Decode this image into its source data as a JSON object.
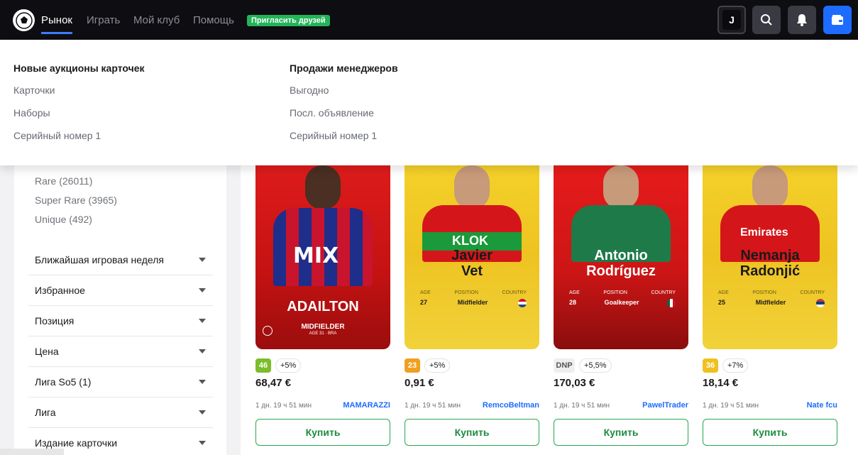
{
  "nav": {
    "items": [
      "Рынок",
      "Играть",
      "Мой клуб",
      "Помощь"
    ],
    "invite": "Пригласить друзей",
    "user_initial": "J"
  },
  "dropdown": {
    "left": {
      "title": "Новые аукционы карточек",
      "links": [
        "Карточки",
        "Наборы",
        "Серийный номер 1"
      ]
    },
    "right": {
      "title": "Продажи менеджеров",
      "links": [
        "Выгодно",
        "Посл. объявление",
        "Серийный номер 1"
      ]
    }
  },
  "sidebar": {
    "rarities": [
      "Rare (26011)",
      "Super Rare (3965)",
      "Unique (492)"
    ],
    "filters": [
      "Ближайшая игровая неделя",
      "Избранное",
      "Позиция",
      "Цена",
      "Лига So5 (1)",
      "Лига",
      "Издание карточки"
    ]
  },
  "cards": [
    {
      "name": "ADAILTON",
      "position": "MIDFIELDER",
      "sub": "AGE 31 · BRA",
      "score": "46",
      "score_color": "#7cbd2a",
      "delta": "+5%",
      "price": "68,47 €",
      "time": "1 дн. 19 ч 51 мин",
      "seller": "MAMARAZZI",
      "buy": "Купить"
    },
    {
      "name_line1": "Javier",
      "name_line2": "Vet",
      "age_label": "AGE",
      "position_label": "POSITION",
      "country_label": "COUNTRY",
      "age": "27",
      "position": "Midfielder",
      "score": "23",
      "score_color": "#f0a020",
      "delta": "+5%",
      "price": "0,91 €",
      "time": "1 дн. 19 ч 51 мин",
      "seller": "RemcoBeltman",
      "buy": "Купить"
    },
    {
      "name_line1": "Antonio",
      "name_line2": "Rodríguez",
      "age_label": "AGE",
      "position_label": "POSITION",
      "country_label": "COUNTRY",
      "age": "28",
      "position": "Goalkeeper",
      "score": "DNP",
      "delta": "+5,5%",
      "price": "170,03 €",
      "time": "1 дн. 19 ч 51 мин",
      "seller": "PawelTrader",
      "buy": "Купить"
    },
    {
      "name_line1": "Nemanja",
      "name_line2": "Radonjić",
      "age_label": "AGE",
      "position_label": "POSITION",
      "country_label": "COUNTRY",
      "age": "25",
      "position": "Midfielder",
      "score": "36",
      "score_color": "#f0c020",
      "delta": "+7%",
      "price": "18,14 €",
      "time": "1 дн. 19 ч 51 мин",
      "seller": "Nate fcu",
      "buy": "Купить"
    }
  ]
}
